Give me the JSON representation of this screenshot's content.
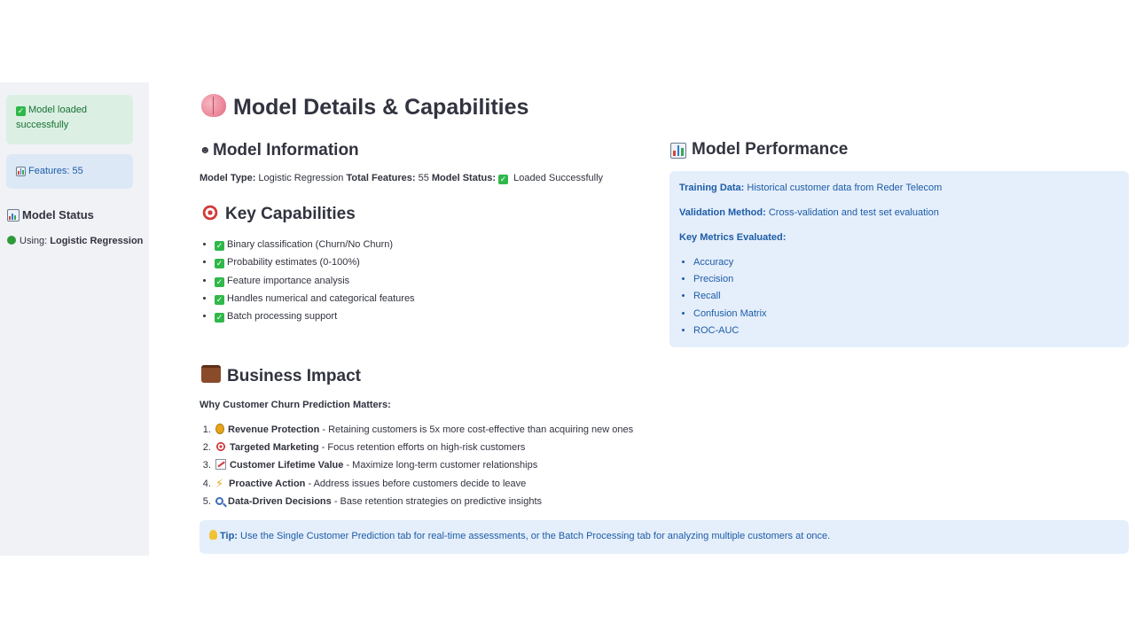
{
  "sidebar": {
    "success_message": "Model loaded successfully",
    "features_message": "Features: 55",
    "status_heading": "Model Status",
    "using_label": "Using:",
    "using_value": "Logistic Regression"
  },
  "main": {
    "title": "Model Details & Capabilities",
    "model_information": {
      "heading": "Model Information",
      "model_type_label": "Model Type:",
      "model_type_value": "Logistic Regression",
      "total_features_label": "Total Features:",
      "total_features_value": "55",
      "model_status_label": "Model Status:",
      "model_status_value": "Loaded Successfully"
    },
    "capabilities": {
      "heading": "Key Capabilities",
      "items": [
        "Binary classification (Churn/No Churn)",
        "Probability estimates (0-100%)",
        "Feature importance analysis",
        "Handles numerical and categorical features",
        "Batch processing support"
      ]
    },
    "performance": {
      "heading": "Model Performance",
      "training_label": "Training Data:",
      "training_value": "Historical customer data from Reder Telecom",
      "validation_label": "Validation Method:",
      "validation_value": "Cross-validation and test set evaluation",
      "metrics_label": "Key Metrics Evaluated:",
      "metrics": [
        "Accuracy",
        "Precision",
        "Recall",
        "Confusion Matrix",
        "ROC-AUC"
      ]
    },
    "business": {
      "heading": "Business Impact",
      "why": "Why Customer Churn Prediction Matters:",
      "items": [
        {
          "title": "Revenue Protection",
          "desc": " - Retaining customers is 5x more cost-effective than acquiring new ones",
          "icon": "medal-icon"
        },
        {
          "title": "Targeted Marketing",
          "desc": " - Focus retention efforts on high-risk customers",
          "icon": "target-icon"
        },
        {
          "title": "Customer Lifetime Value",
          "desc": " - Maximize long-term customer relationships",
          "icon": "chart-up-icon"
        },
        {
          "title": "Proactive Action",
          "desc": " - Address issues before customers decide to leave",
          "icon": "bolt-icon"
        },
        {
          "title": "Data-Driven Decisions",
          "desc": " - Base retention strategies on predictive insights",
          "icon": "magnifier-icon"
        }
      ]
    },
    "tip": {
      "label": "Tip:",
      "text": "Use the Single Customer Prediction tab for real-time assessments, or the Batch Processing tab for analyzing multiple customers at once."
    }
  },
  "colors": {
    "sidebar_bg": "#f0f2f6",
    "success_bg": "#dcefe3",
    "info_bg": "#e5eefb",
    "info_text": "#1c5da6",
    "text": "#31333f"
  }
}
